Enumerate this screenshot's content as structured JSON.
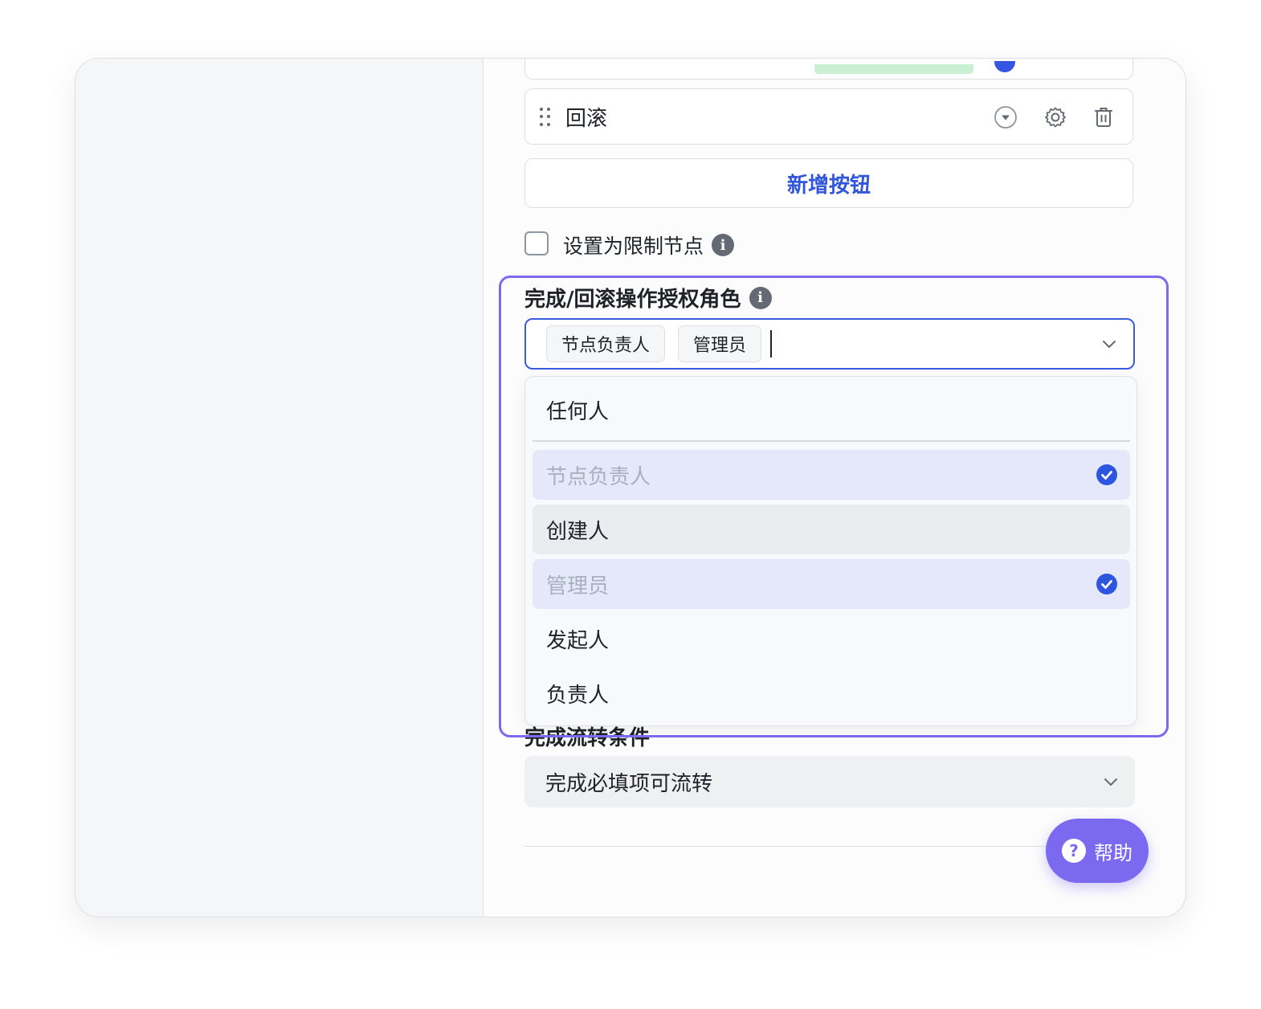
{
  "buttons_list": {
    "rows": [
      {
        "label": "回滚"
      }
    ]
  },
  "add_button": {
    "label": "新增按钮"
  },
  "restrict_node": {
    "label": "设置为限制节点",
    "checked": false
  },
  "auth_roles": {
    "label": "完成/回滚操作授权角色",
    "selected_tags": [
      "节点负责人",
      "管理员"
    ],
    "options": [
      {
        "label": "任何人",
        "selected": false
      },
      {
        "label": "节点负责人",
        "selected": true
      },
      {
        "label": "创建人",
        "selected": false
      },
      {
        "label": "管理员",
        "selected": true
      },
      {
        "label": "发起人",
        "selected": false
      },
      {
        "label": "负责人",
        "selected": false
      }
    ]
  },
  "flow_condition": {
    "label": "完成流转条件",
    "value": "完成必填项可流转"
  },
  "help": {
    "label": "帮助"
  },
  "colors": {
    "accent": "#3a5be0",
    "highlight": "#7a6af0",
    "help_button": "#7b69ef",
    "selected_option_bg": "#e4e8fa"
  }
}
